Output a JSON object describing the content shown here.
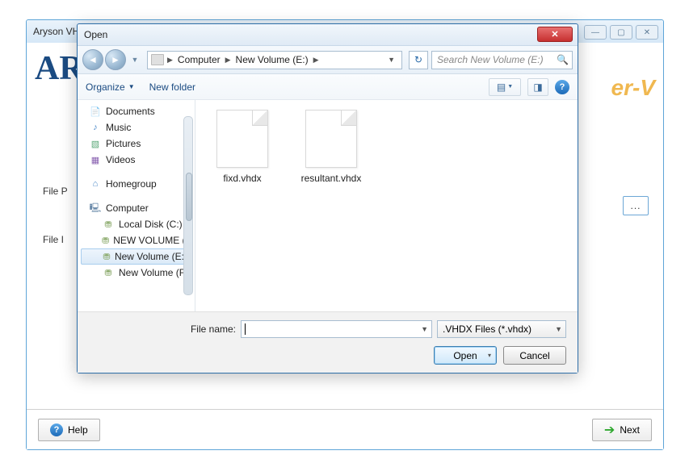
{
  "parent": {
    "title": "Aryson VH",
    "logo_text": "AR",
    "hyperv_fragment": "er-V",
    "labels": {
      "file_path": "File P",
      "file_info": "File I"
    },
    "browse_label": "...",
    "help_label": "Help",
    "next_label": "Next"
  },
  "dialog": {
    "title": "Open",
    "breadcrumb": {
      "root": "Computer",
      "current": "New Volume (E:)"
    },
    "search_placeholder": "Search New Volume (E:)",
    "toolbar": {
      "organize": "Organize",
      "new_folder": "New folder"
    },
    "tree": [
      {
        "label": "Documents",
        "icon": "doc",
        "indent": false
      },
      {
        "label": "Music",
        "icon": "music",
        "indent": false
      },
      {
        "label": "Pictures",
        "icon": "pic",
        "indent": false
      },
      {
        "label": "Videos",
        "icon": "vid",
        "indent": false
      },
      {
        "label": "Homegroup",
        "icon": "home",
        "indent": false,
        "gap_before": true
      },
      {
        "label": "Computer",
        "icon": "comp",
        "indent": false,
        "gap_before": true
      },
      {
        "label": "Local Disk (C:)",
        "icon": "disk",
        "indent": true
      },
      {
        "label": "NEW VOLUME (D",
        "icon": "disk",
        "indent": true
      },
      {
        "label": "New Volume (E:)",
        "icon": "disk",
        "indent": true,
        "selected": true
      },
      {
        "label": "New Volume (F:)",
        "icon": "disk",
        "indent": true
      }
    ],
    "files": [
      {
        "name": "fixd.vhdx"
      },
      {
        "name": "resultant.vhdx"
      }
    ],
    "filename_label": "File name:",
    "filename_value": "",
    "filter": ".VHDX Files (*.vhdx)",
    "open_label": "Open",
    "cancel_label": "Cancel"
  }
}
